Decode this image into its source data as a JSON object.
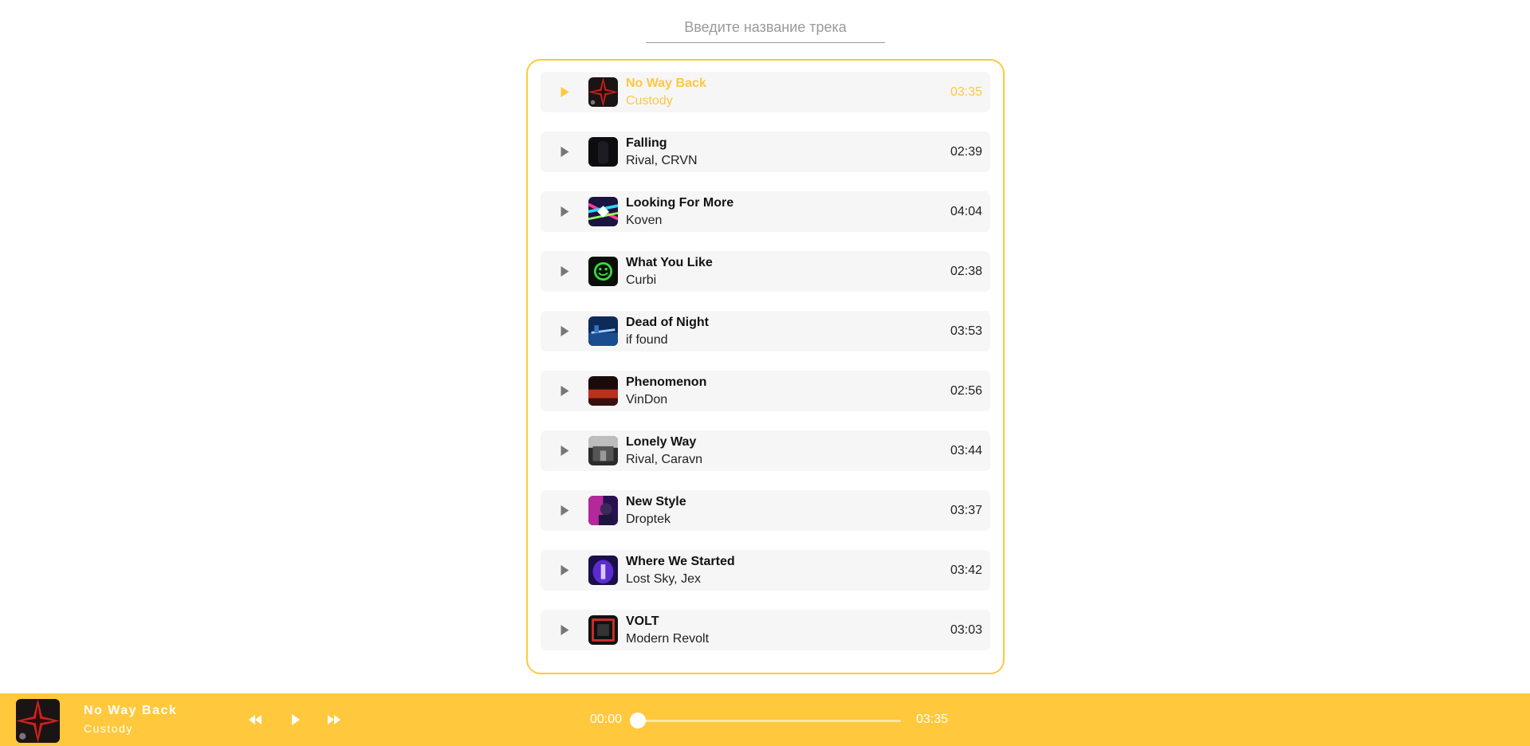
{
  "search": {
    "placeholder": "Введите название трека",
    "value": ""
  },
  "colors": {
    "accent": "#ffc83d",
    "row_bg": "#f6f6f6",
    "play_icon": "#777777"
  },
  "tracks": [
    {
      "title": "No Way Back",
      "artist": "Custody",
      "duration": "03:35",
      "active": true,
      "cover_icon": "red-cross-cover"
    },
    {
      "title": "Falling",
      "artist": "Rival, CRVN",
      "duration": "02:39",
      "active": false,
      "cover_icon": "dark-figure-cover"
    },
    {
      "title": "Looking For More",
      "artist": "Koven",
      "duration": "04:04",
      "active": false,
      "cover_icon": "rainbow-diamond-cover"
    },
    {
      "title": "What You Like",
      "artist": "Curbi",
      "duration": "02:38",
      "active": false,
      "cover_icon": "green-smiley-cover"
    },
    {
      "title": "Dead of Night",
      "artist": "if found",
      "duration": "03:53",
      "active": false,
      "cover_icon": "blue-city-cover"
    },
    {
      "title": "Phenomenon",
      "artist": "VinDon",
      "duration": "02:56",
      "active": false,
      "cover_icon": "red-landscape-cover"
    },
    {
      "title": "Lonely Way",
      "artist": "Rival, Caravn",
      "duration": "03:44",
      "active": false,
      "cover_icon": "grey-street-cover"
    },
    {
      "title": "New Style",
      "artist": "Droptek",
      "duration": "03:37",
      "active": false,
      "cover_icon": "pink-portrait-cover"
    },
    {
      "title": "Where We Started",
      "artist": "Lost Sky, Jex",
      "duration": "03:42",
      "active": false,
      "cover_icon": "purple-figure-cover"
    },
    {
      "title": "VOLT",
      "artist": "Modern Revolt",
      "duration": "03:03",
      "active": false,
      "cover_icon": "red-frame-cover"
    }
  ],
  "player": {
    "title": "No Way Back",
    "artist": "Custody",
    "current_time": "00:00",
    "total_time": "03:35",
    "progress": 0,
    "controls": [
      "rewind-icon",
      "play-icon",
      "fast-forward-icon"
    ]
  }
}
